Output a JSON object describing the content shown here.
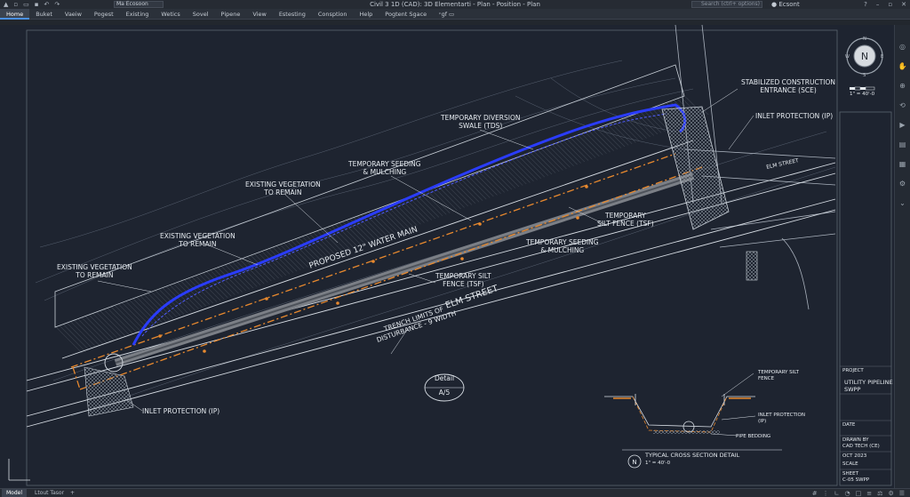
{
  "app": {
    "title": "Civil 3 1D (CAD): 3D Elementarti - Plan - Position - Plan",
    "workspace": "Ma Ecosoon",
    "search_placeholder": "Search (ctrl+ options)",
    "user": "Ecsont",
    "help_icon": "?"
  },
  "ribbon_tabs": [
    {
      "label": "Home",
      "active": true
    },
    {
      "label": "Buket",
      "active": false
    },
    {
      "label": "Vaeiw",
      "active": false
    },
    {
      "label": "Pogest",
      "active": false
    },
    {
      "label": "Existing",
      "active": false
    },
    {
      "label": "Wetics",
      "active": false
    },
    {
      "label": "Sovel",
      "active": false
    },
    {
      "label": "Pipene",
      "active": false
    },
    {
      "label": "View",
      "active": false
    },
    {
      "label": "Estesting",
      "active": false
    },
    {
      "label": "Consption",
      "active": false
    },
    {
      "label": "Help",
      "active": false
    },
    {
      "label": "Pogtent Sgace",
      "active": false
    },
    {
      "label": "ᶜgf ▭",
      "active": false
    }
  ],
  "colors": {
    "background": "#1e2430",
    "linework": "#c9d0d8",
    "water_main": "#7b7f86",
    "silt_fence": "#e8892e",
    "diversion_swale": "#2a3cff",
    "accent": "#4a90e2"
  },
  "plan_labels": {
    "sce": "STABILIZED CONSTRUCTION\nENTRANCE (SCE)",
    "ip_top": "INLET PROTECTION (IP)",
    "tds": "TEMPORARY DIVERSION\nSWALE (TDS)",
    "seeding_1": "TEMPORARY SEEDING\n& MULCHING",
    "veg_1": "EXISTING VEGETATION\nTO REMAIN",
    "veg_2": "EXISTING VEGETATION\nTO REMAIN",
    "veg_3": "EXISTING VEGETATION\nTO REMAIN",
    "tsf_1": "TEMPORARY\nSILT FENCE (TSF)",
    "seeding_2": "TEMPORARY SEEDING\n& MULCHING",
    "tsf_2": "TEMPORARY SILT\nFENCE (TSF)",
    "water_main": "PROPOSED 12\" WATER MAIN",
    "elm_street": "ELM STREET",
    "trench": "TRENCH LIMITS OF\nDISTURBANCE - 9 WIDTH",
    "ip_bottom": "INLET PROTECTION (IP)",
    "detail": "Detail",
    "detail_ref": "A/5",
    "street_right": "ELM STREET"
  },
  "section_detail": {
    "title": "TYPICAL CROSS SECTION DETAIL",
    "scale": "1\" = 40'-0",
    "callout_1": "TEMPORARY SILT\nFENCE",
    "callout_2": "INLET PROTECTION\n(IP)",
    "callout_3": "PIPE BEDDING"
  },
  "compass": {
    "letter": "N",
    "scale_text": "1\" = 40'-0"
  },
  "title_block": {
    "project_label": "PROJECT",
    "project": "UTILITY PIPELINE\nSWPP",
    "date_label": "DATE",
    "date": "OCT 2023",
    "drawn_label": "DRAWN BY",
    "drawn": "CAD TECH (CE)",
    "scale_label": "SCALE",
    "sheet_label": "SHEET",
    "sheet": "C-05 SWPP"
  },
  "status": {
    "model_tab": "Model",
    "layout_tab": "Ltout Tasor",
    "add_tab": "+"
  }
}
